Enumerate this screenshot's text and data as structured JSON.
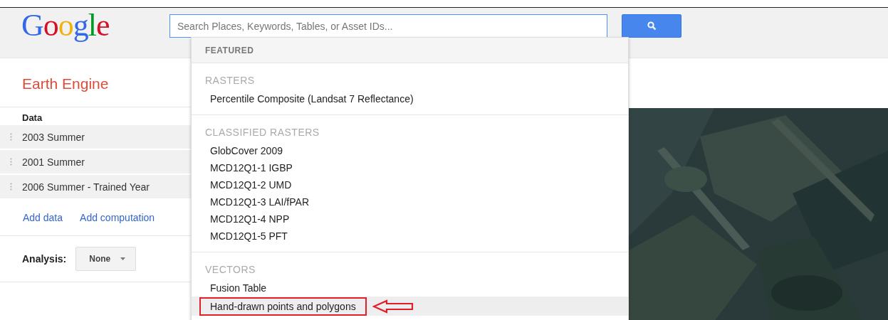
{
  "logo": "Google",
  "search": {
    "placeholder": "Search Places, Keywords, Tables, or Asset IDs..."
  },
  "sidebar": {
    "title": "Earth Engine",
    "data_heading": "Data",
    "layers": [
      "2003 Summer",
      "2001 Summer",
      "2006 Summer - Trained Year"
    ],
    "links": [
      "Add data",
      "Add computation"
    ],
    "analysis": {
      "label": "Analysis:",
      "value": "None"
    }
  },
  "dropdown": {
    "sections": [
      {
        "kind": "featured",
        "heading": "FEATURED"
      },
      {
        "kind": "group",
        "heading": "RASTERS",
        "items": [
          {
            "label": "Percentile Composite (Landsat 7 Reflectance)",
            "selected": false,
            "annotated": false
          }
        ]
      },
      {
        "kind": "group",
        "heading": "CLASSIFIED RASTERS",
        "items": [
          {
            "label": "GlobCover 2009",
            "selected": false,
            "annotated": false
          },
          {
            "label": "MCD12Q1-1 IGBP",
            "selected": false,
            "annotated": false
          },
          {
            "label": "MCD12Q1-2 UMD",
            "selected": false,
            "annotated": false
          },
          {
            "label": "MCD12Q1-3 LAI/fPAR",
            "selected": false,
            "annotated": false
          },
          {
            "label": "MCD12Q1-4 NPP",
            "selected": false,
            "annotated": false
          },
          {
            "label": "MCD12Q1-5 PFT",
            "selected": false,
            "annotated": false
          }
        ]
      },
      {
        "kind": "group",
        "heading": "VECTORS",
        "items": [
          {
            "label": "Fusion Table",
            "selected": false,
            "annotated": false
          },
          {
            "label": "Hand-drawn points and polygons",
            "selected": true,
            "annotated": true
          }
        ]
      }
    ]
  }
}
